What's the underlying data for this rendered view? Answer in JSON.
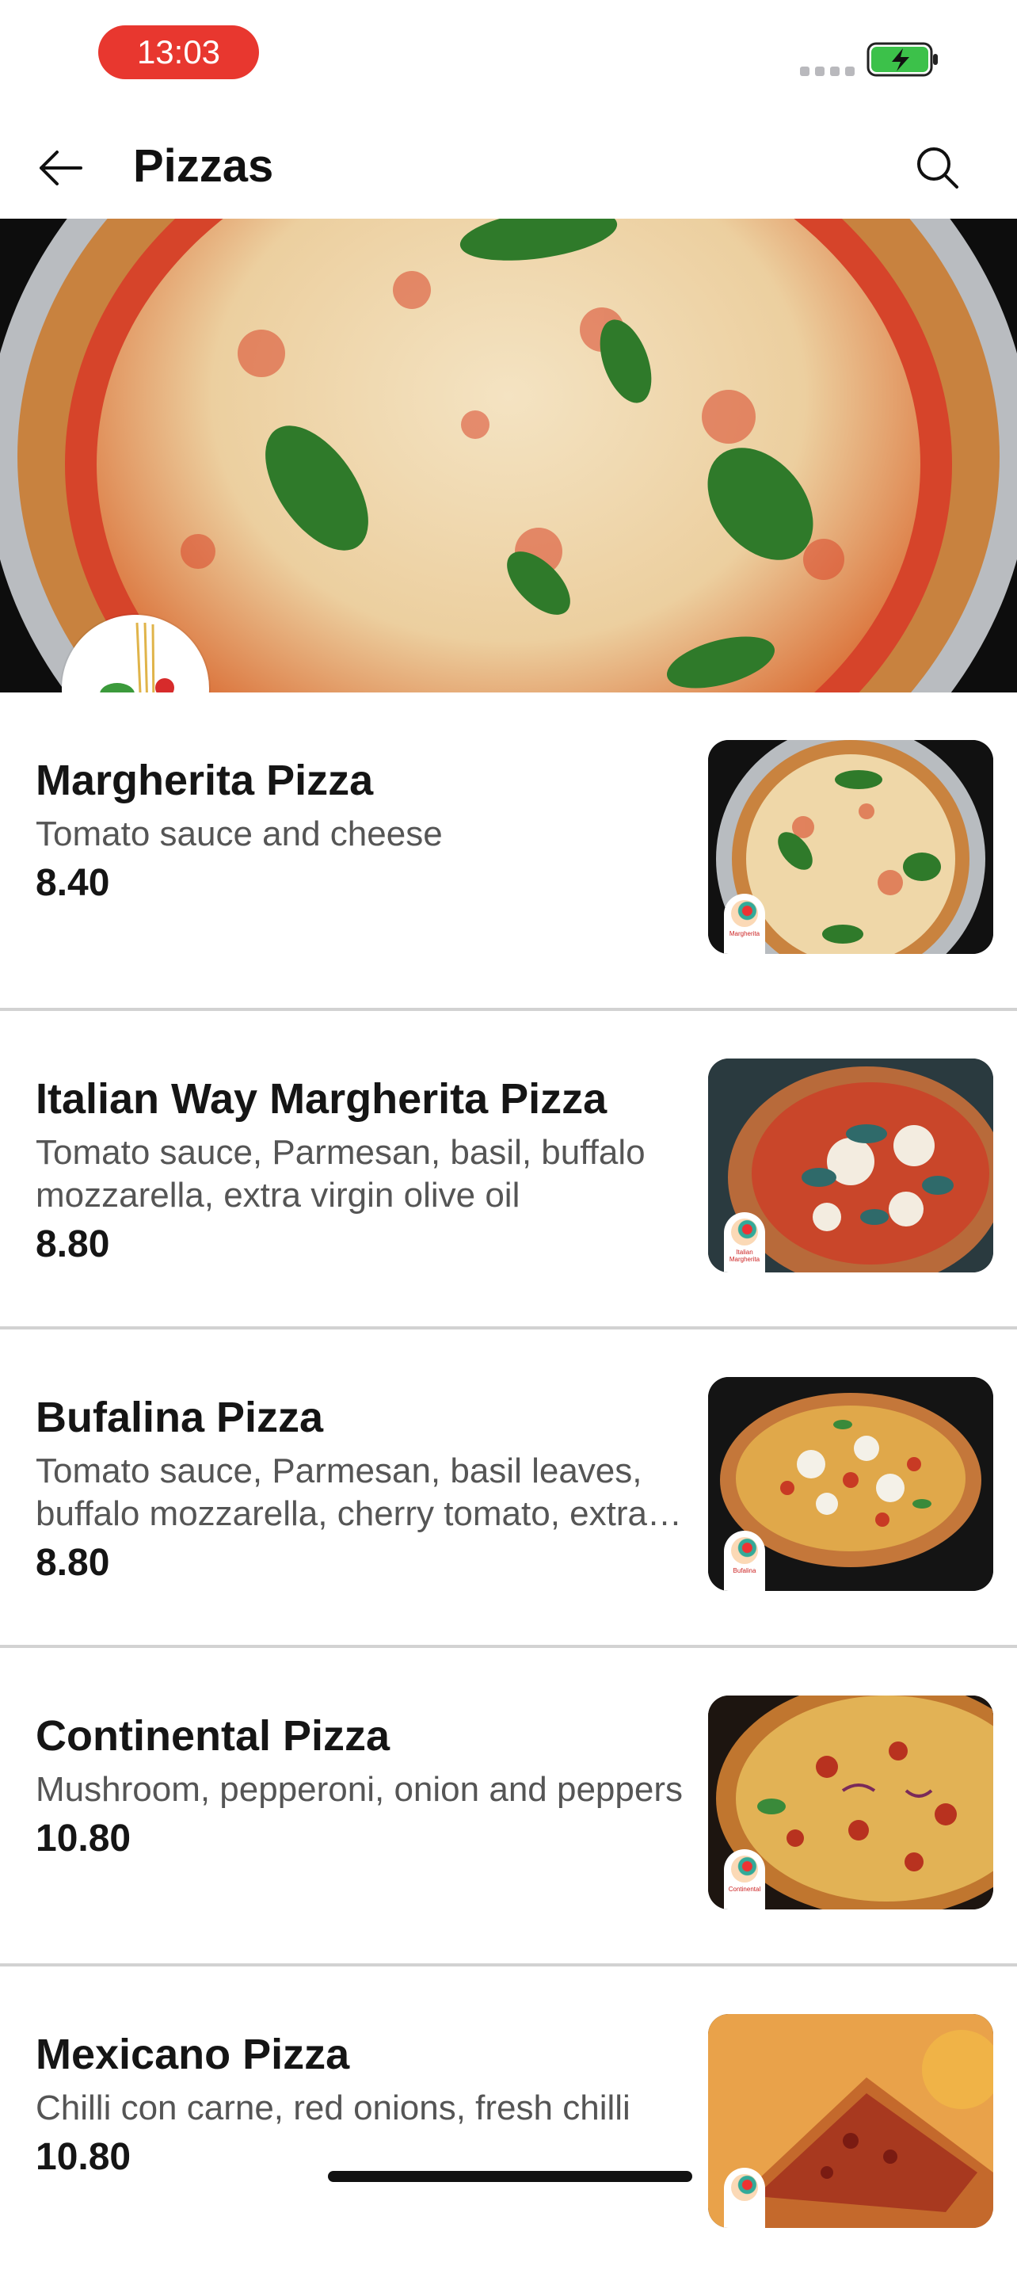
{
  "status_bar": {
    "time": "13:03"
  },
  "header": {
    "title": "Pizzas"
  },
  "items": [
    {
      "name": "Margherita Pizza",
      "description": "Tomato sauce and cheese",
      "price": "8.40",
      "badge": "Margherita"
    },
    {
      "name": "Italian Way Margherita Pizza",
      "description": "Tomato sauce, Parmesan, basil, buffalo mozzarella, extra virgin olive oil",
      "price": "8.80",
      "badge": "Italian Margherita"
    },
    {
      "name": "Bufalina Pizza",
      "description": "Tomato sauce, Parmesan, basil leaves, buffalo mozzarella, cherry tomato, extra virgin olive oil",
      "price": "8.80",
      "badge": "Bufalina"
    },
    {
      "name": "Continental Pizza",
      "description": "Mushroom, pepperoni, onion and peppers",
      "price": "10.80",
      "badge": "Continental"
    },
    {
      "name": "Mexicano Pizza",
      "description": "Chilli con carne, red onions, fresh chilli",
      "price": "10.80",
      "badge": ""
    }
  ],
  "colors": {
    "accent": "#e8372f",
    "battery": "#3cc14a"
  }
}
